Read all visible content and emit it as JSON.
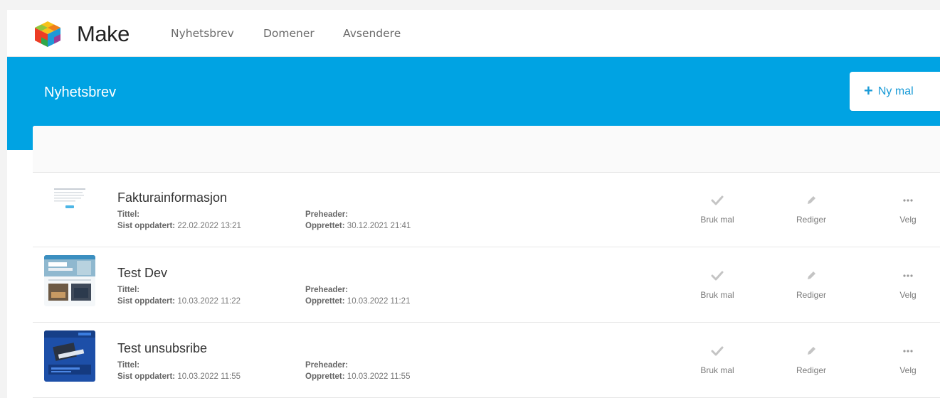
{
  "app": {
    "brand": "Make"
  },
  "nav": [
    {
      "label": "Nyhetsbrev"
    },
    {
      "label": "Domener"
    },
    {
      "label": "Avsendere"
    }
  ],
  "page": {
    "title": "Nyhetsbrev",
    "new_button": "Ny mal"
  },
  "labels": {
    "tittel": "Tittel:",
    "preheader": "Preheader:",
    "updated": "Sist oppdatert:",
    "created": "Opprettet:"
  },
  "actions": {
    "use": "Bruk mal",
    "edit": "Rediger",
    "select": "Velg"
  },
  "templates": [
    {
      "name": "Fakturainformasjon",
      "updated": "22.02.2022 13:21",
      "created": "30.12.2021 21:41",
      "thumb": "invoice-preview"
    },
    {
      "name": "Test Dev",
      "updated": "10.03.2022 11:22",
      "created": "10.03.2022 11:21",
      "thumb": "photo-newsletter-preview"
    },
    {
      "name": "Test unsubsribe",
      "updated": "10.03.2022 11:55",
      "created": "10.03.2022 11:55",
      "thumb": "blue-newsletter-preview"
    }
  ],
  "colors": {
    "hero": "#00a3e3",
    "accent": "#1a9bd7"
  }
}
